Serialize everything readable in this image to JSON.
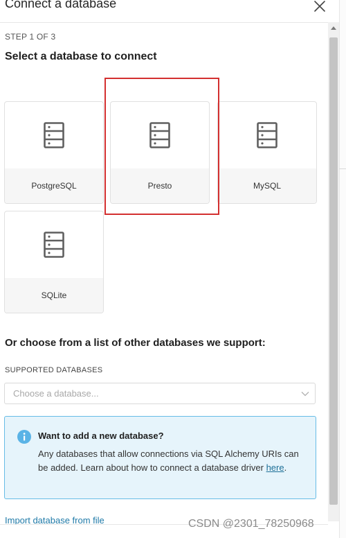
{
  "modal": {
    "title": "Connect a database",
    "step": "STEP 1 OF 3",
    "subtitle": "Select a database to connect",
    "databases": [
      {
        "label": "PostgreSQL",
        "icon": "database-server-icon"
      },
      {
        "label": "Presto",
        "icon": "database-server-icon"
      },
      {
        "label": "MySQL",
        "icon": "database-server-icon"
      },
      {
        "label": "SQLite",
        "icon": "database-server-icon"
      }
    ],
    "other_title": "Or choose from a list of other databases we support:",
    "supported_label": "SUPPORTED DATABASES",
    "select_placeholder": "Choose a database...",
    "alert": {
      "title": "Want to add a new database?",
      "body_prefix": "Any databases that allow connections via SQL Alchemy URIs can be added. Learn about how to connect a database driver ",
      "link": "here",
      "body_suffix": "."
    },
    "import_link": "Import database from file"
  },
  "watermark": "CSDN @2301_78250968",
  "colors": {
    "highlight": "#d32f2f",
    "alert_border": "#66bce6",
    "alert_bg": "#e6f4fb",
    "info_icon": "#5ab3e6",
    "link": "#1f7aa8"
  }
}
